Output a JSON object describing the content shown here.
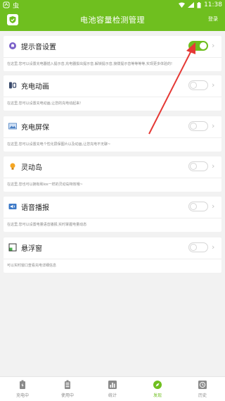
{
  "status_bar": {
    "app_badge": "虫",
    "time": "11:38"
  },
  "header": {
    "title": "电池容量检测管理",
    "action_label": "登录"
  },
  "settings": [
    {
      "icon": "bell-icon",
      "title": "提示音设置",
      "desc": "在这里,您可以设置充电器插入提示音,充电器拔出提示音,解锁提示音,接拨提示音等等等等,实现更多体验的!",
      "enabled": true
    },
    {
      "icon": "phone-icon",
      "title": "充电动画",
      "desc": "在这里,您可以设置充电动画,让您的充电动起来!",
      "enabled": false
    },
    {
      "icon": "image-icon",
      "title": "充电屏保",
      "desc": "在这里,您可以设置充电个性化屏保图片以及动画,让您充电不无聊~",
      "enabled": false
    },
    {
      "icon": "bulb-icon",
      "title": "灵动岛",
      "desc": "在这里,您也可以拥有和ios一样的灵动岛特效哦~",
      "enabled": false
    },
    {
      "icon": "speaker-icon",
      "title": "语音播报",
      "desc": "在这里,您可以设置电量语音播报,实时掌握电量动态",
      "enabled": false
    },
    {
      "icon": "floating-window-icon",
      "title": "悬浮窗",
      "desc": "可以实时窗口查看充电详细信息",
      "enabled": false
    }
  ],
  "tabs": [
    {
      "label": "充电中",
      "icon": "battery-charging-icon",
      "active": false
    },
    {
      "label": "使用中",
      "icon": "battery-icon",
      "active": false
    },
    {
      "label": "统计",
      "icon": "bar-chart-icon",
      "active": false
    },
    {
      "label": "发现",
      "icon": "compass-icon",
      "active": true
    },
    {
      "label": "历史",
      "icon": "history-icon",
      "active": false
    }
  ],
  "colors": {
    "accent": "#6fbf1f",
    "arrow": "#e53935"
  }
}
